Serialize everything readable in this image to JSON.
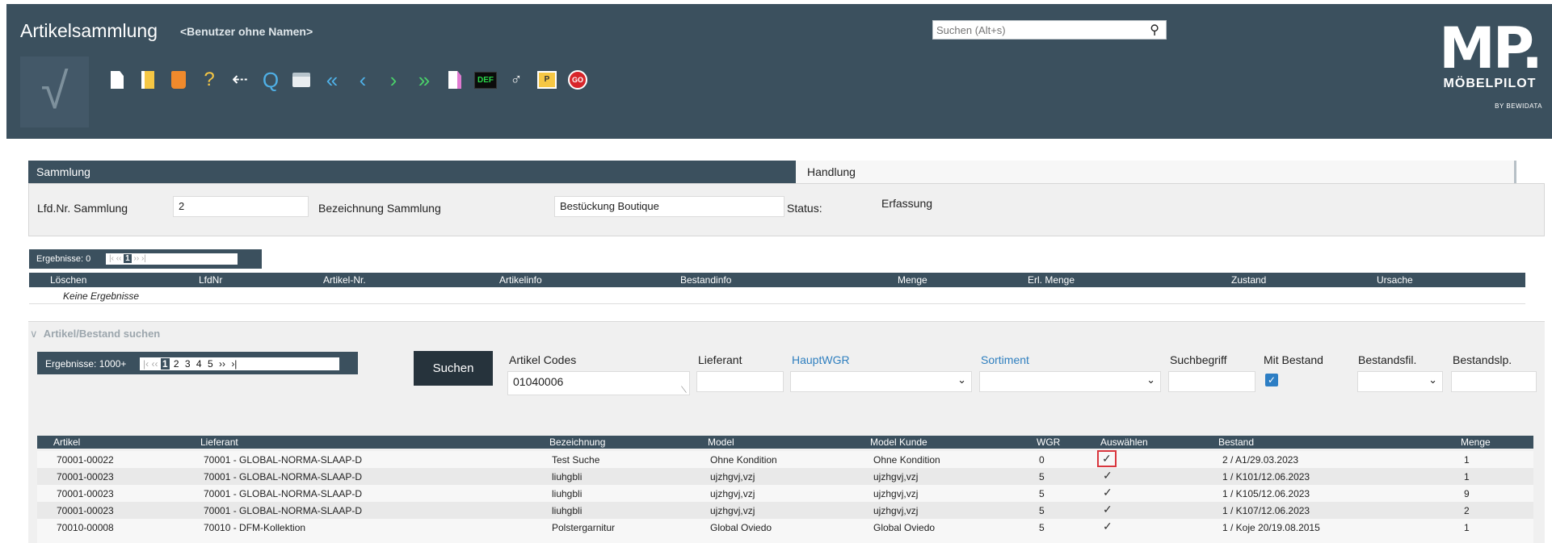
{
  "header": {
    "app_title": "Artikelsammlung",
    "user_name": "<Benutzer ohne Namen>",
    "search_placeholder": "Suchen (Alt+s)",
    "logo_mp": "MP.",
    "logo_brand": "MÖBELPILOT",
    "logo_by": "BY BEWIDATA",
    "toolbar_icons": [
      "new-document-icon",
      "edit-document-icon",
      "delete-icon",
      "help-icon",
      "back-dropdown-icon",
      "search-icon",
      "print-icon",
      "first-record-icon",
      "previous-record-icon",
      "next-record-icon",
      "last-record-icon",
      "document-pink-icon",
      "def-icon",
      "user-check-icon",
      "document-p-icon",
      "go-icon"
    ]
  },
  "toolbar": {
    "help": "?",
    "back": "⇠",
    "search": "Q",
    "first": "«",
    "prev": "‹",
    "next": "›",
    "last": "»",
    "def": "DEF",
    "go": "GO"
  },
  "tabs": {
    "sammlung": "Sammlung",
    "handlung": "Handlung"
  },
  "form": {
    "lfd_label": "Lfd.Nr. Sammlung",
    "lfd_value": "2",
    "bez_label": "Bezeichnung Sammlung",
    "bez_value": "Bestückung Boutique",
    "status_label": "Status:",
    "status_value": "Erfassung"
  },
  "results1": {
    "count": "Ergebnisse: 0",
    "pager": {
      "first": "|‹",
      "prev": "‹‹",
      "page": "1",
      "next": "››",
      "last": "›|"
    },
    "columns": [
      "Löschen",
      "LfdNr",
      "Artikel-Nr.",
      "Artikelinfo",
      "Bestandinfo",
      "Menge",
      "Erl. Menge",
      "Zustand",
      "Ursache"
    ],
    "empty_text": "Keine Ergebnisse"
  },
  "search": {
    "section_title": "Artikel/Bestand suchen",
    "collapse_icon": "chevron-down-icon",
    "count": "Ergebnisse: 1000+",
    "pager": {
      "first": "|‹",
      "prev": "‹‹",
      "current": "1",
      "pages": [
        "2",
        "3",
        "4",
        "5"
      ],
      "next": "››",
      "last": "›|"
    },
    "button": "Suchen",
    "fields": {
      "codes_label": "Artikel Codes",
      "codes_value": "01040006",
      "lieferant_label": "Lieferant",
      "hauptwgr_label": "HauptWGR",
      "sortiment_label": "Sortiment",
      "suchbegriff_label": "Suchbegriff",
      "mit_bestand_label": "Mit Bestand",
      "mit_bestand_checked": true,
      "bestandsfil_label": "Bestandsfil.",
      "bestandslp_label": "Bestandslp."
    }
  },
  "results2": {
    "columns": [
      "Artikel",
      "Lieferant",
      "Bezeichnung",
      "Model",
      "Model Kunde",
      "WGR",
      "Auswählen",
      "Bestand",
      "Menge"
    ],
    "rows": [
      {
        "artikel": "70001-00022",
        "lieferant": "70001 - GLOBAL-NORMA-SLAAP-D",
        "bezeichnung": "Test Suche",
        "model": "Ohne Kondition",
        "model_kunde": "Ohne Kondition",
        "wgr": "0",
        "auswaehlen": "✓",
        "bestand": "2 / A1/29.03.2023",
        "menge": "1"
      },
      {
        "artikel": "70001-00023",
        "lieferant": "70001 - GLOBAL-NORMA-SLAAP-D",
        "bezeichnung": "liuhgbli",
        "model": "ujzhgvj,vzj",
        "model_kunde": "ujzhgvj,vzj",
        "wgr": "5",
        "auswaehlen": "✓",
        "bestand": "1 / K101/12.06.2023",
        "menge": "1"
      },
      {
        "artikel": "70001-00023",
        "lieferant": "70001 - GLOBAL-NORMA-SLAAP-D",
        "bezeichnung": "liuhgbli",
        "model": "ujzhgvj,vzj",
        "model_kunde": "ujzhgvj,vzj",
        "wgr": "5",
        "auswaehlen": "✓",
        "bestand": "1 / K105/12.06.2023",
        "menge": "9"
      },
      {
        "artikel": "70001-00023",
        "lieferant": "70001 - GLOBAL-NORMA-SLAAP-D",
        "bezeichnung": "liuhgbli",
        "model": "ujzhgvj,vzj",
        "model_kunde": "ujzhgvj,vzj",
        "wgr": "5",
        "auswaehlen": "✓",
        "bestand": "1 / K107/12.06.2023",
        "menge": "2"
      },
      {
        "artikel": "70010-00008",
        "lieferant": "70010 - DFM-Kollektion",
        "bezeichnung": "Polstergarnitur",
        "model": "Global Oviedo",
        "model_kunde": "Global Oviedo",
        "wgr": "5",
        "auswaehlen": "✓",
        "bestand": "1 / Koje 20/19.08.2015",
        "menge": "1"
      }
    ]
  },
  "colors": {
    "header_bg": "#3b505e",
    "panel_bg": "#f0f0f0",
    "link": "#2f7fbf",
    "highlight": "#d9363e"
  }
}
